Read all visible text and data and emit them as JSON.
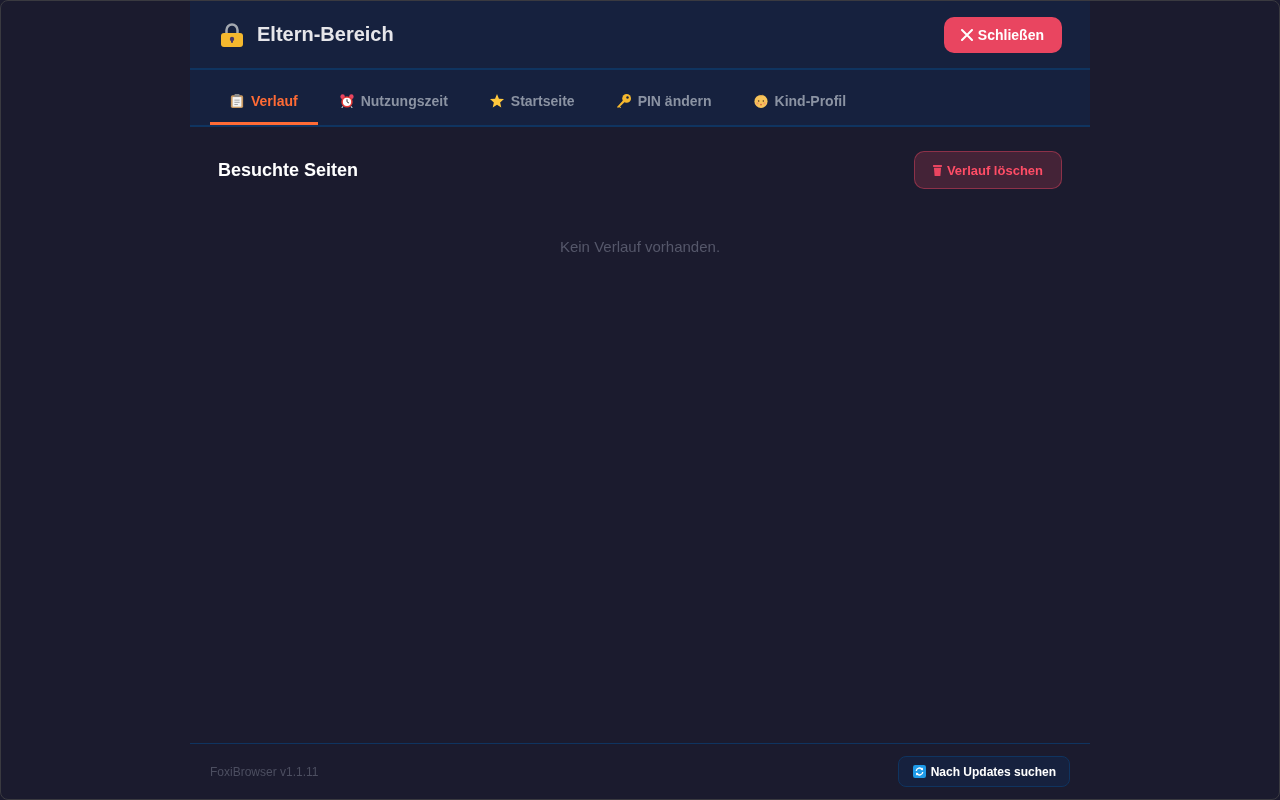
{
  "header": {
    "title": "Eltern-Bereich",
    "close_button": "Schließen"
  },
  "tabs": [
    {
      "label": "Verlauf",
      "selected": true
    },
    {
      "label": "Nutzungszeit",
      "selected": false
    },
    {
      "label": "Startseite",
      "selected": false
    },
    {
      "label": "PIN ändern",
      "selected": false
    },
    {
      "label": "Kind-Profil",
      "selected": false
    }
  ],
  "section": {
    "title": "Besuchte Seiten",
    "clear_button": "Verlauf löschen",
    "empty_message": "Kein Verlauf vorhanden."
  },
  "footer": {
    "version": "FoxiBrowser v1.1.11",
    "update_button": "Nach Updates suchen"
  }
}
